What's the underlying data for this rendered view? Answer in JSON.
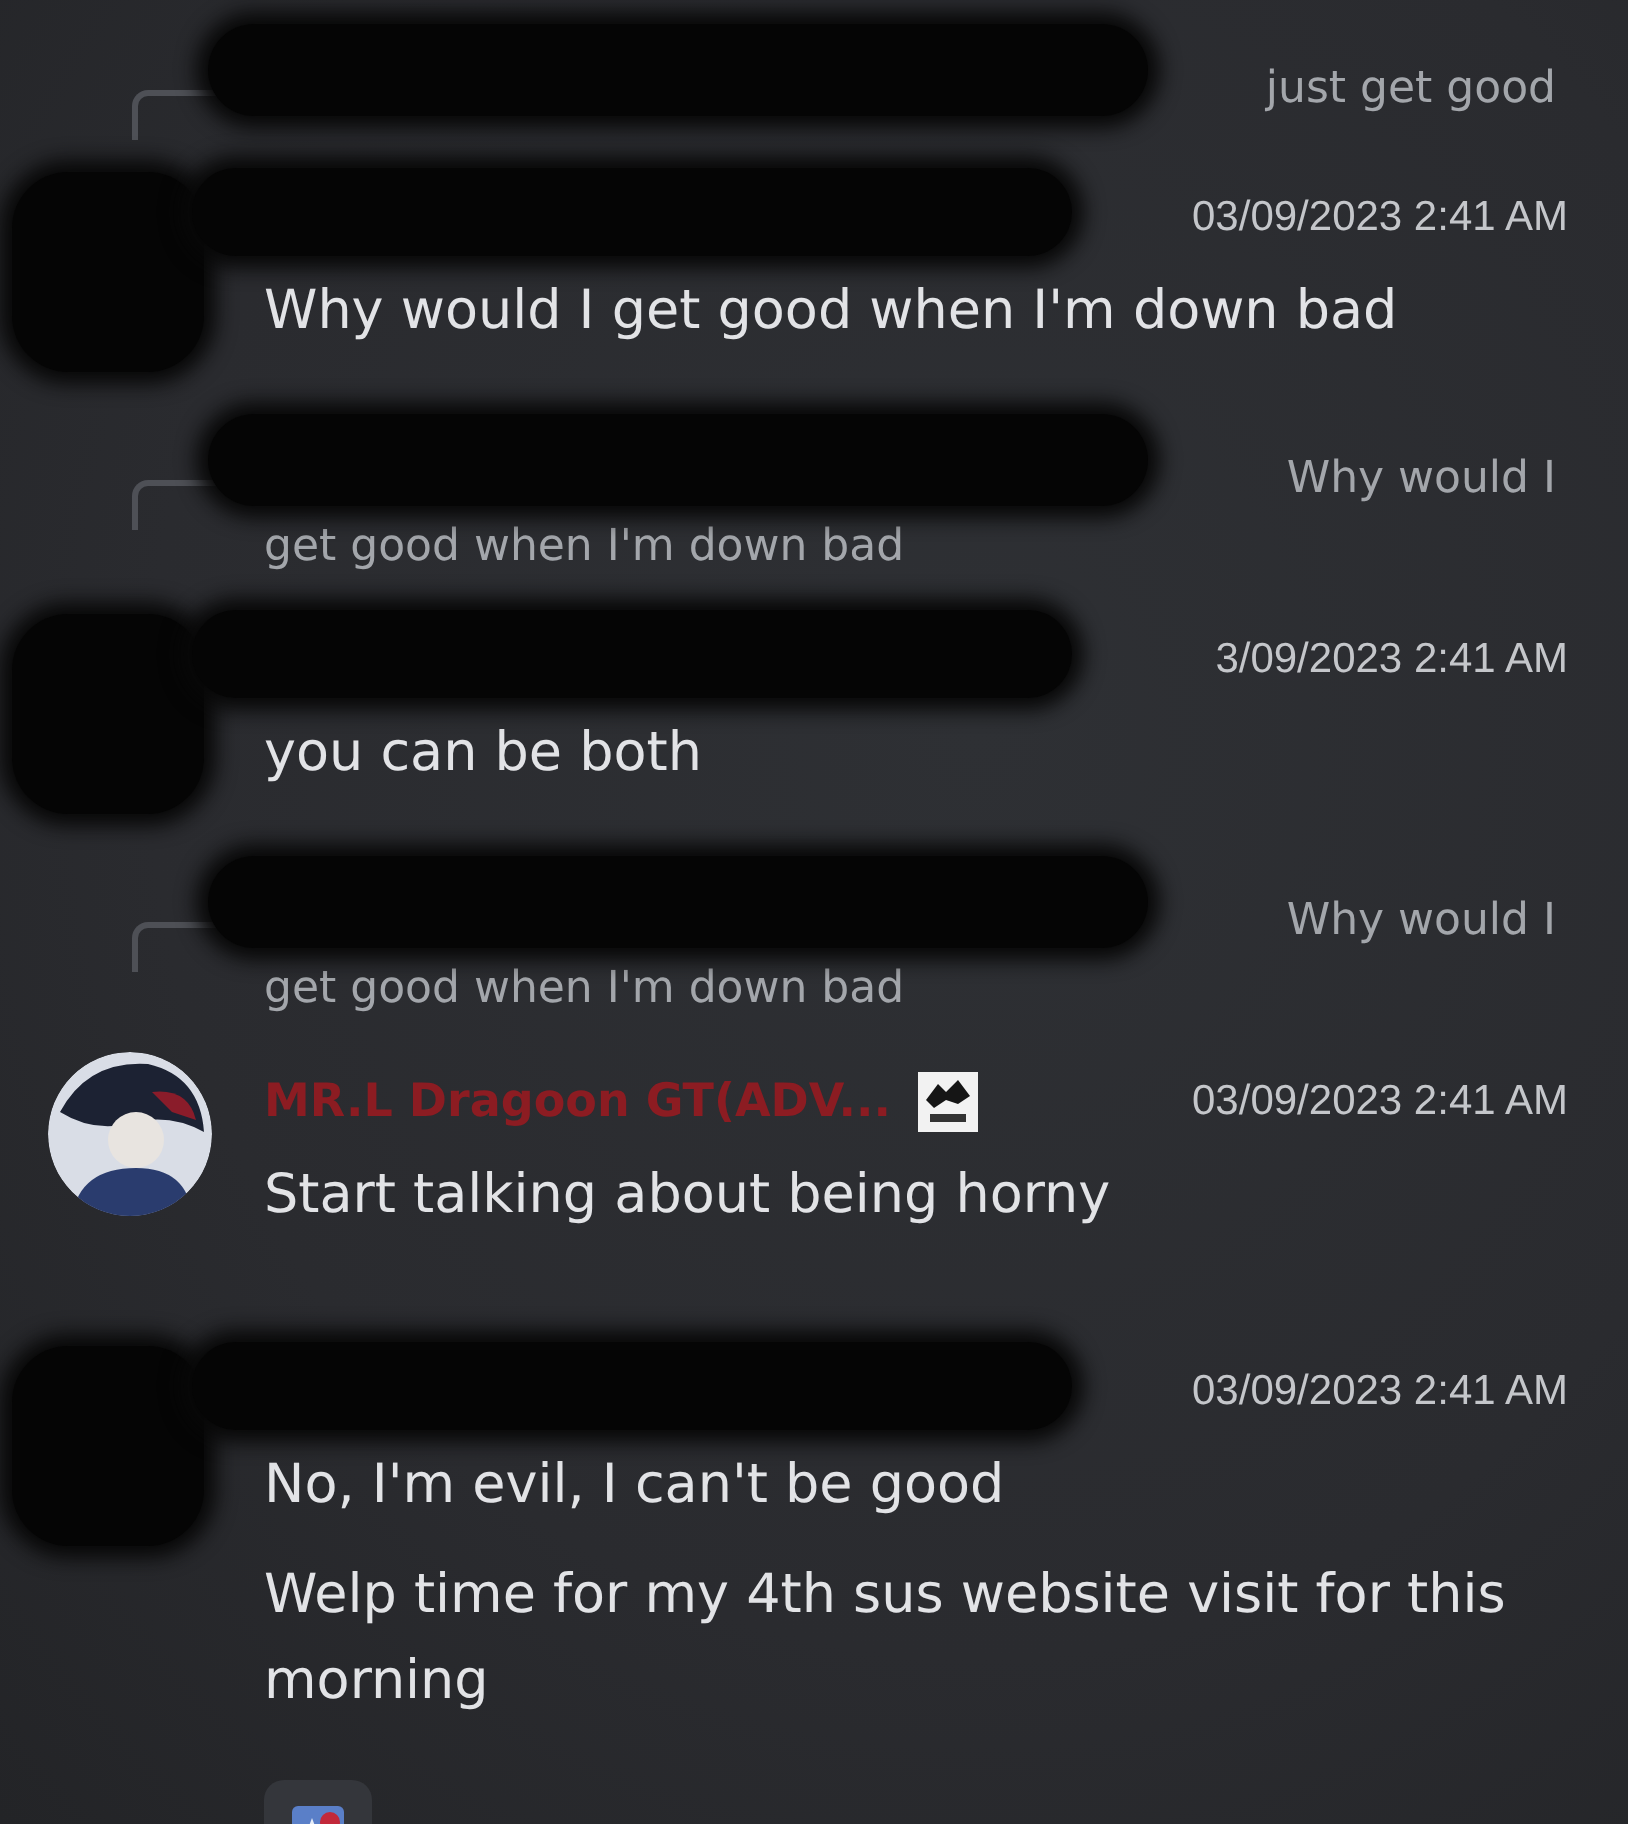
{
  "messages": [
    {
      "reply": {
        "redacted": true,
        "lines": [
          "just get good"
        ]
      },
      "header": {
        "redacted": true,
        "timestamp": "03/09/2023 2:41 AM"
      },
      "lines": [
        "Why would I get good when I'm down bad"
      ]
    },
    {
      "reply": {
        "redacted": true,
        "lines": [
          "Why would I",
          "get good when I'm down bad"
        ]
      },
      "header": {
        "redacted": true,
        "timestamp": "3/09/2023 2:41 AM"
      },
      "lines": [
        "you can be both"
      ]
    },
    {
      "reply": {
        "redacted": true,
        "lines": [
          "Why would I",
          "get good when I'm down bad"
        ]
      },
      "header": {
        "redacted": false,
        "author": "MR.L Dragoon GT(ADV...",
        "badge": true,
        "timestamp": "03/09/2023 2:41 AM"
      },
      "lines": [
        "Start talking about being horny"
      ]
    },
    {
      "header": {
        "redacted": true,
        "timestamp": "03/09/2023 2:41 AM"
      },
      "lines": [
        "No, I'm evil, I can't be good",
        "Welp time for my 4th sus website visit for this morning"
      ],
      "reactions": [
        {
          "kind": "emoji"
        }
      ]
    }
  ]
}
